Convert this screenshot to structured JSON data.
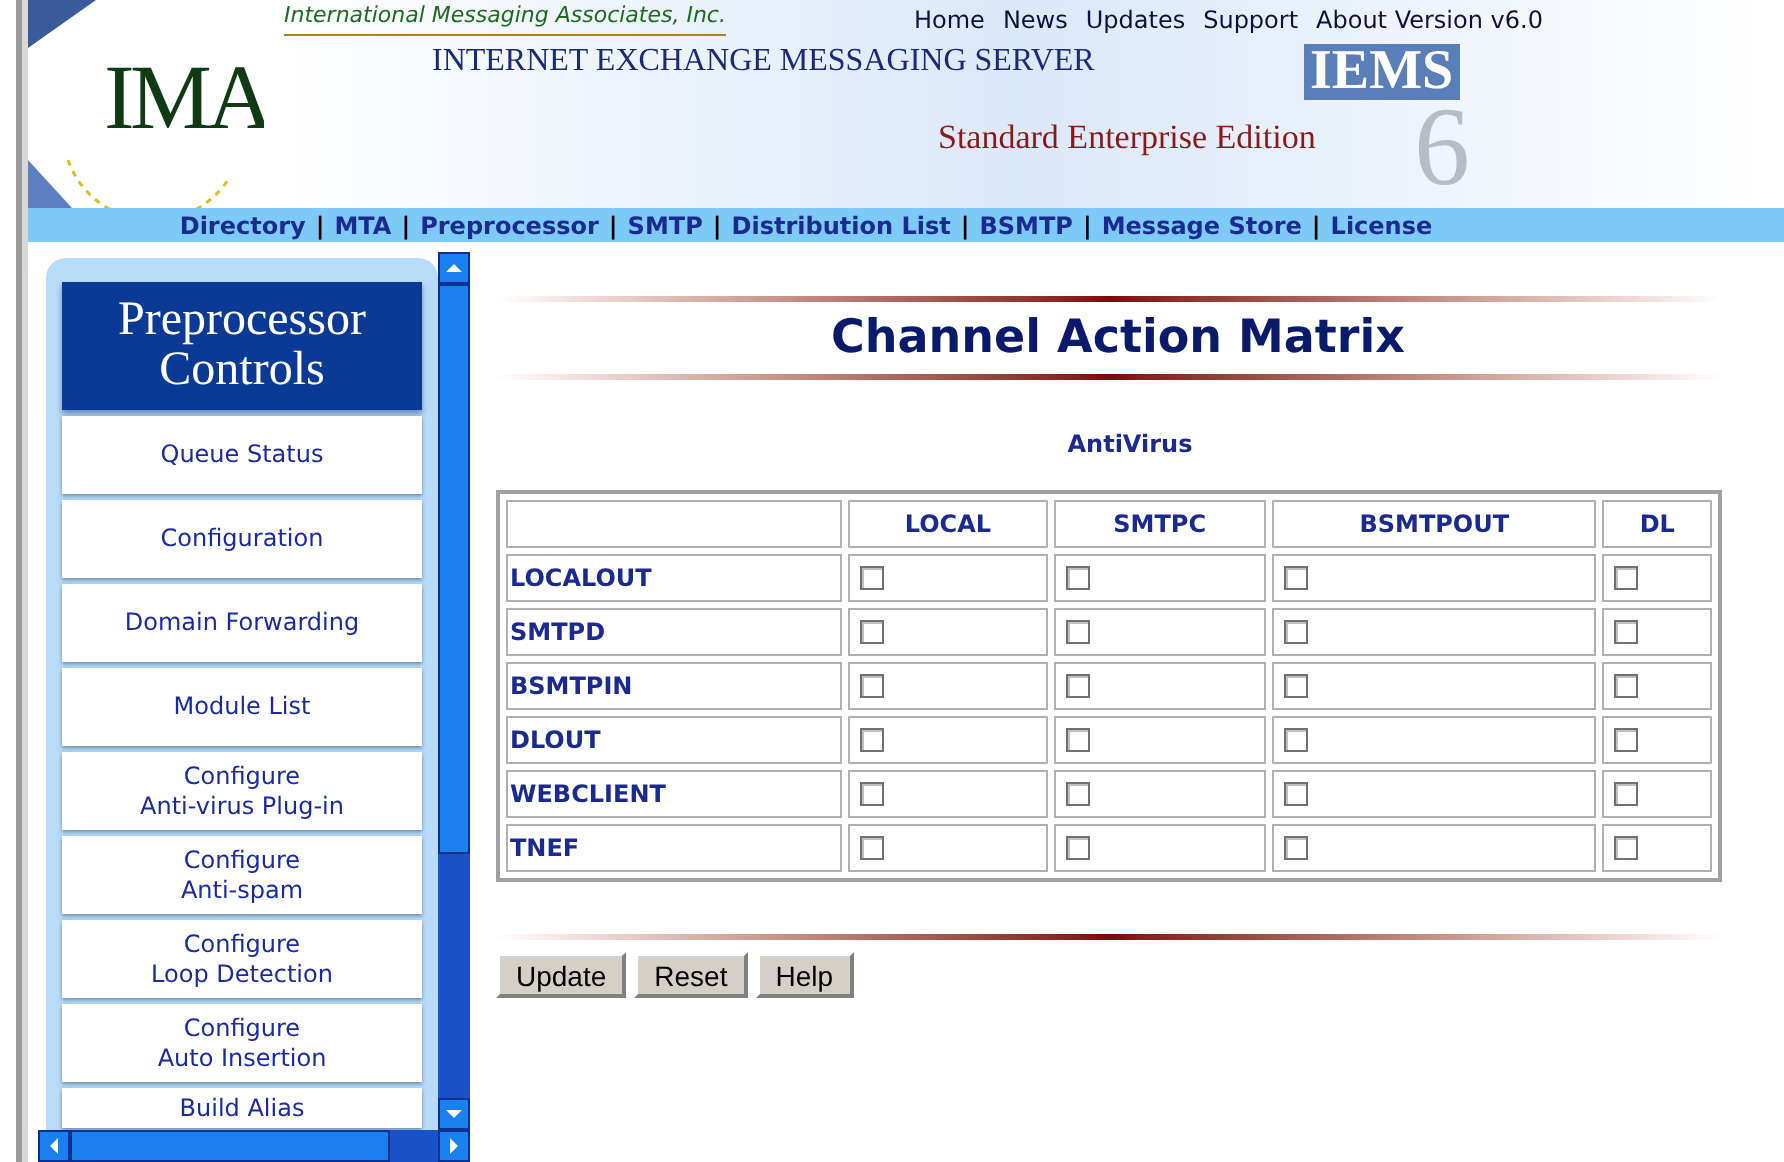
{
  "header": {
    "company": "International Messaging Associates, Inc.",
    "logo": "IMA",
    "links": [
      {
        "label": "Home"
      },
      {
        "label": "News"
      },
      {
        "label": "Updates"
      },
      {
        "label": "Support"
      },
      {
        "label": "About Version v6.0"
      }
    ],
    "product": "INTERNET EXCHANGE MESSAGING SERVER",
    "product_short": "IEMS",
    "version_mark": "6",
    "edition": "Standard Enterprise Edition"
  },
  "nav": [
    {
      "kind": "link",
      "label": "Directory"
    },
    {
      "kind": "separator",
      "label": "|"
    },
    {
      "kind": "link",
      "label": "MTA"
    },
    {
      "kind": "separator",
      "label": "|"
    },
    {
      "kind": "link",
      "label": "Preprocessor"
    },
    {
      "kind": "separator",
      "label": "|"
    },
    {
      "kind": "link",
      "label": "SMTP"
    },
    {
      "kind": "separator",
      "label": "|"
    },
    {
      "kind": "link",
      "label": "Distribution List"
    },
    {
      "kind": "separator",
      "label": "|"
    },
    {
      "kind": "link",
      "label": "BSMTP"
    },
    {
      "kind": "separator",
      "label": "|"
    },
    {
      "kind": "link",
      "label": "Message Store"
    },
    {
      "kind": "separator",
      "label": "|"
    },
    {
      "kind": "link",
      "label": "License"
    }
  ],
  "sidebar": {
    "title": [
      "Preprocessor",
      "Controls"
    ],
    "items": [
      [
        "Queue Status"
      ],
      [
        "Configuration"
      ],
      [
        "Domain Forwarding"
      ],
      [
        "Module List"
      ],
      [
        "Configure",
        "Anti-virus Plug-in"
      ],
      [
        "Configure",
        "Anti-spam"
      ],
      [
        "Configure",
        "Loop Detection"
      ],
      [
        "Configure",
        "Auto Insertion"
      ],
      [
        "Build Alias"
      ]
    ]
  },
  "page": {
    "title": "Channel Action Matrix",
    "subtitle": "AntiVirus"
  },
  "table": {
    "columns": [
      "LOCAL",
      "SMTPC",
      "BSMTPOUT",
      "DL"
    ],
    "rows": [
      {
        "label": "LOCALOUT",
        "cells": [
          {
            "checked": false
          },
          {
            "checked": false
          },
          {
            "checked": false
          },
          {
            "checked": false
          }
        ]
      },
      {
        "label": "SMTPD",
        "cells": [
          {
            "checked": false
          },
          {
            "checked": false
          },
          {
            "checked": false
          },
          {
            "checked": false
          }
        ]
      },
      {
        "label": "BSMTPIN",
        "cells": [
          {
            "checked": false
          },
          {
            "checked": false
          },
          {
            "checked": false
          },
          {
            "checked": false
          }
        ]
      },
      {
        "label": "DLOUT",
        "cells": [
          {
            "checked": false
          },
          {
            "checked": false
          },
          {
            "checked": false
          },
          {
            "checked": false
          }
        ]
      },
      {
        "label": "WEBCLIENT",
        "cells": [
          {
            "checked": false
          },
          {
            "checked": false
          },
          {
            "checked": false
          },
          {
            "checked": false
          }
        ]
      },
      {
        "label": "TNEF",
        "cells": [
          {
            "checked": false
          },
          {
            "checked": false
          },
          {
            "checked": false
          },
          {
            "checked": false
          }
        ]
      }
    ]
  },
  "buttons": [
    "Update",
    "Reset",
    "Help"
  ]
}
